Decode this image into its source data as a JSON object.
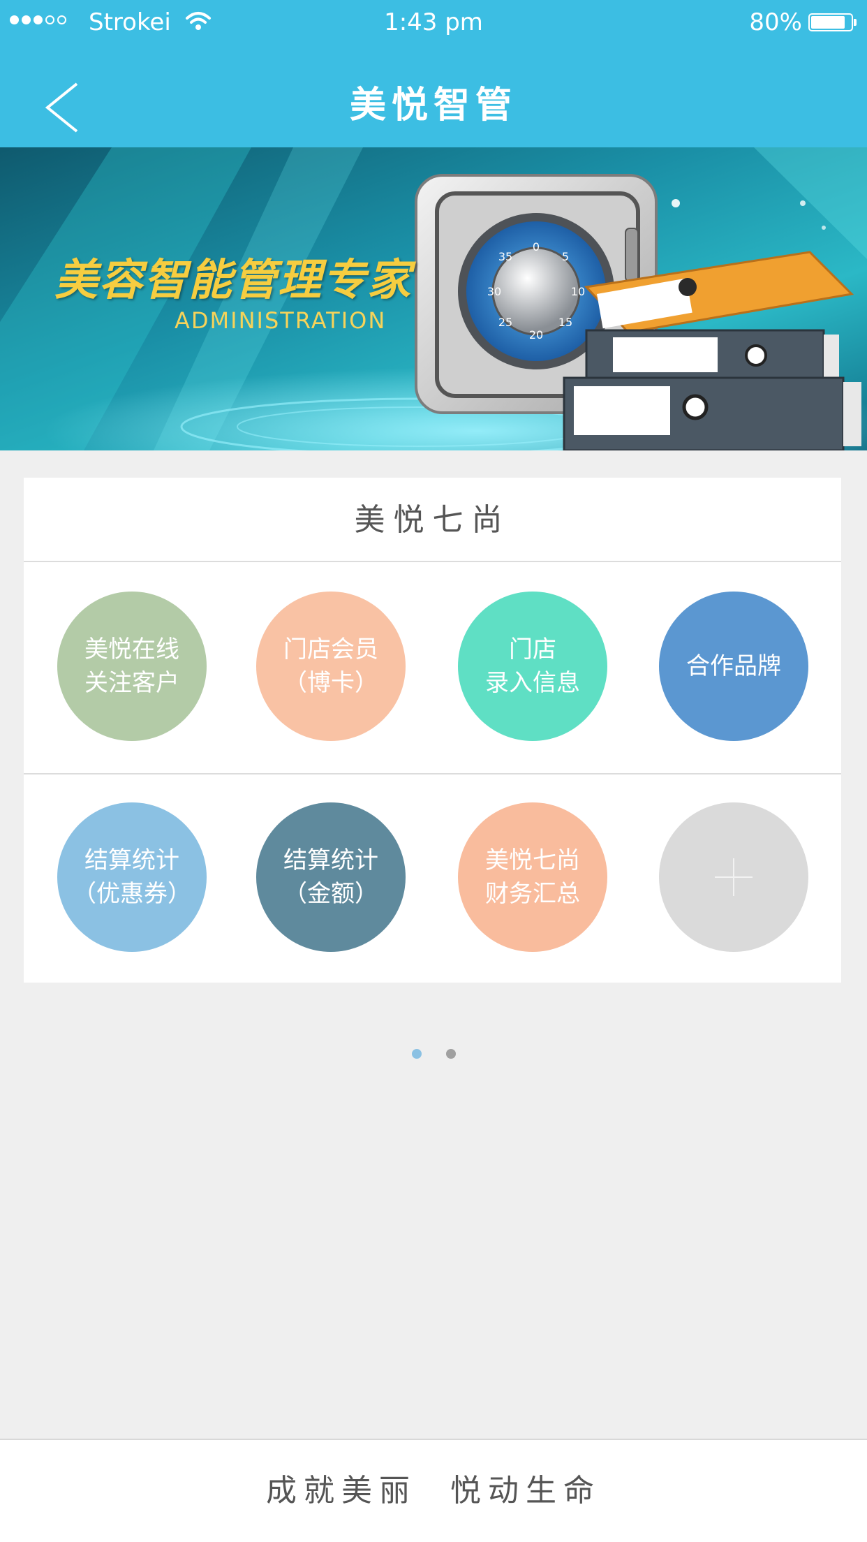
{
  "status_bar": {
    "carrier": "Strokei",
    "time": "1:43 pm",
    "battery": "80%"
  },
  "nav": {
    "title": "美悦智管",
    "back_icon": "chevron-left-icon"
  },
  "banner": {
    "title": "美容智能管理专家",
    "subtitle": "ADMINISTRATION",
    "dial_numbers": [
      "0",
      "5",
      "10",
      "15",
      "20",
      "25",
      "30",
      "35"
    ]
  },
  "card": {
    "title": "美悦七尚",
    "tiles": [
      {
        "label": "美悦在线\n关注客户",
        "color": "#b3cba7"
      },
      {
        "label": "门店会员\n（博卡）",
        "color": "#f9c2a4"
      },
      {
        "label": "门店\n录入信息",
        "color": "#5fdfc4"
      },
      {
        "label": "合作品牌",
        "color": "#5b97d1"
      },
      {
        "label": "结算统计\n（优惠券）",
        "color": "#8bc1e3"
      },
      {
        "label": "结算统计\n（金额）",
        "color": "#5f8a9d"
      },
      {
        "label": "美悦七尚\n财务汇总",
        "color": "#f9bc9d"
      },
      {
        "label": "",
        "icon": "plus-icon",
        "color": "#dadada"
      }
    ]
  },
  "pagination": {
    "active_color": "#8bc1e3",
    "inactive_color": "#a0a0a0"
  },
  "footer": {
    "slogan": "成就美丽  悦动生命"
  }
}
